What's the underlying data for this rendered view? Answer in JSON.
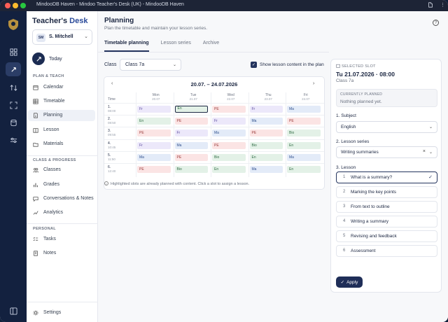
{
  "window": {
    "title": "MindooDB Haven - Mindoo Teacher's Desk (UK) - MindooDB Haven"
  },
  "brand": {
    "part1": "Teacher's",
    "part2": "Desk"
  },
  "user": {
    "initials": "SM",
    "name": "S. Mitchell"
  },
  "sidebar": {
    "today": "Today",
    "section_plan": "PLAN & TEACH",
    "plan_items": [
      "Calendar",
      "Timetable",
      "Planning",
      "Lesson",
      "Materials"
    ],
    "section_class": "CLASS & PROGRESS",
    "class_items": [
      "Classes",
      "Grades",
      "Conversations & Notes",
      "Analytics"
    ],
    "section_personal": "PERSONAL",
    "personal_items": [
      "Tasks",
      "Notes"
    ],
    "settings": "Settings"
  },
  "page": {
    "title": "Planning",
    "subtitle": "Plan the timetable and maintain your lesson series."
  },
  "tabs": [
    "Timetable planning",
    "Lesson series",
    "Archive"
  ],
  "filters": {
    "class_label": "Class",
    "class_value": "Class 7a",
    "show_content_label": "Show lesson content in the plan",
    "show_content_checked": true
  },
  "timetable": {
    "range": "20.07. – 24.07.2026",
    "time_header": "Time",
    "days": [
      {
        "name": "Mon",
        "date": "20.07"
      },
      {
        "name": "Tue",
        "date": "21.07"
      },
      {
        "name": "Wed",
        "date": "22.07"
      },
      {
        "name": "Thu",
        "date": "23.07"
      },
      {
        "name": "Fri",
        "date": "24.07"
      }
    ],
    "periods": [
      {
        "num": "1.",
        "time": "08:00",
        "cells": [
          "Fr",
          "En",
          "PE",
          "Fr",
          "Ma"
        ]
      },
      {
        "num": "2.",
        "time": "08:50",
        "cells": [
          "En",
          "PE",
          "Fr",
          "Ma",
          "PE"
        ]
      },
      {
        "num": "3.",
        "time": "09:55",
        "cells": [
          "PE",
          "Fr",
          "Ma",
          "PE",
          "Bio"
        ]
      },
      {
        "num": "4.",
        "time": "10:45",
        "cells": [
          "Fr",
          "Ma",
          "PE",
          "Bio",
          "En"
        ]
      },
      {
        "num": "5.",
        "time": "11:50",
        "cells": [
          "Ma",
          "PE",
          "Bio",
          "En",
          "Ma"
        ]
      },
      {
        "num": "6.",
        "time": "12:40",
        "cells": [
          "PE",
          "Bio",
          "En",
          "Ma",
          "En"
        ]
      }
    ],
    "selected": {
      "period": 0,
      "day": 1
    },
    "note": "Highlighted slots are already planned with content. Click a slot to assign a lesson."
  },
  "subject_colors": {
    "Fr": {
      "bg": "#ece8fa",
      "fg": "#5b4a9e"
    },
    "En": {
      "bg": "#e3f1e7",
      "fg": "#2f6b43"
    },
    "PE": {
      "bg": "#fbe4e4",
      "fg": "#9a3a3a"
    },
    "Ma": {
      "bg": "#e3ebf8",
      "fg": "#2f4f8c"
    },
    "Bio": {
      "bg": "#e3f1e7",
      "fg": "#2f6b43"
    }
  },
  "slot": {
    "label": "SELECTED SLOT",
    "date": "Tu 21.07.2026 · 08:00",
    "class": "Class 7a",
    "current_label": "CURRENTLY PLANNED",
    "current_value": "Nothing planned yet.",
    "subject_label": "1. Subject",
    "subject_value": "English",
    "series_label": "2. Lesson series",
    "series_value": "Writing summaries",
    "lesson_label": "3. Lesson",
    "lessons": [
      {
        "n": "1",
        "t": "What is a summary?"
      },
      {
        "n": "2",
        "t": "Marking the key points"
      },
      {
        "n": "3",
        "t": "From text to outline"
      },
      {
        "n": "4",
        "t": "Writing a summary"
      },
      {
        "n": "5",
        "t": "Revising and feedback"
      },
      {
        "n": "6",
        "t": "Assessment"
      }
    ],
    "selected_lesson": 0,
    "apply": "Apply"
  }
}
